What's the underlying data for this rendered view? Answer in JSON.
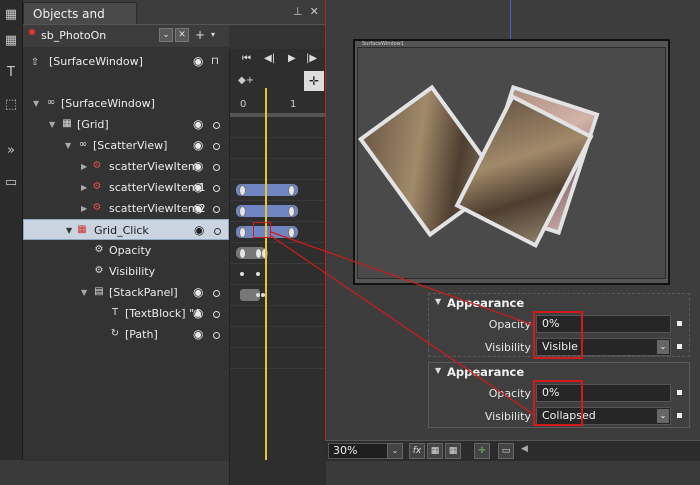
{
  "panel": {
    "title": "Objects and Timeline",
    "storyboard": "sb_PhotoOn",
    "root": "[SurfaceWindow]"
  },
  "tree": [
    {
      "label": "[SurfaceWindow]"
    },
    {
      "label": "[Grid]"
    },
    {
      "label": "[ScatterView]"
    },
    {
      "label": "scatterViewItem"
    },
    {
      "label": "scatterViewItem1"
    },
    {
      "label": "scatterViewItem2"
    },
    {
      "label": "Grid_Click"
    },
    {
      "label": "Opacity"
    },
    {
      "label": "Visibility"
    },
    {
      "label": "[StackPanel]"
    },
    {
      "label": "[TextBlock] \"A"
    },
    {
      "label": "[Path]"
    }
  ],
  "timeline": {
    "tick0": "0",
    "tick1": "1"
  },
  "artboard": {
    "window_title": "SurfaceWindow1"
  },
  "appearance1": {
    "title": "Appearance",
    "opacity_label": "Opacity",
    "opacity_value": "0%",
    "visibility_label": "Visibility",
    "visibility_value": "Visible"
  },
  "appearance2": {
    "title": "Appearance",
    "opacity_label": "Opacity",
    "opacity_value": "0%",
    "visibility_label": "Visibility",
    "visibility_value": "Collapsed"
  },
  "bottom": {
    "zoom": "30%",
    "fx": "fx"
  },
  "colors": {
    "accent_red": "#d11a1a",
    "playhead": "#e8c23a",
    "selection": "#c9d4e0"
  }
}
